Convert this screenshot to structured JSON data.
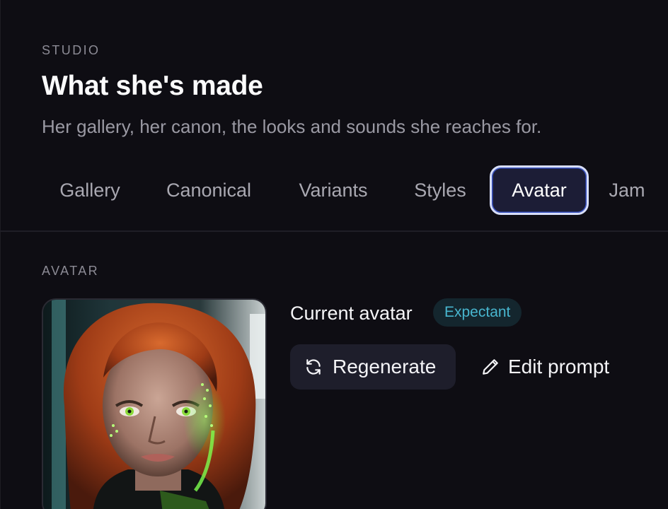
{
  "header": {
    "eyebrow": "STUDIO",
    "title": "What she's made",
    "subtitle": "Her gallery, her canon, the looks and sounds she reaches for."
  },
  "tabs": [
    {
      "label": "Gallery",
      "active": false
    },
    {
      "label": "Canonical",
      "active": false
    },
    {
      "label": "Variants",
      "active": false
    },
    {
      "label": "Styles",
      "active": false
    },
    {
      "label": "Avatar",
      "active": true
    },
    {
      "label": "Jam",
      "active": false
    }
  ],
  "avatar_section": {
    "label": "AVATAR",
    "current_label": "Current avatar",
    "status_badge": "Expectant",
    "regenerate_label": "Regenerate",
    "edit_prompt_label": "Edit prompt",
    "regenerate_icon": "refresh-icon",
    "edit_icon": "pencil-icon"
  },
  "colors": {
    "background": "#0e0d13",
    "active_tab_bg": "#1c1d36",
    "active_tab_border": "#d7defa",
    "badge_text": "#48b6cf",
    "badge_bg": "#14262e"
  }
}
